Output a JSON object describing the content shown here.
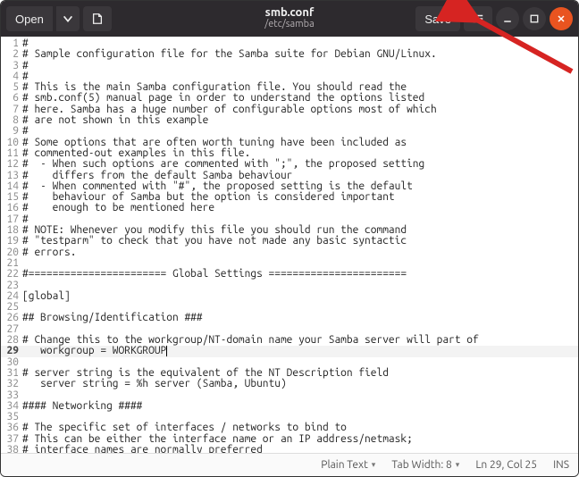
{
  "header": {
    "open_label": "Open",
    "title": "smb.conf",
    "subtitle": "/etc/samba",
    "save_label": "Save"
  },
  "editor": {
    "cursor_line": 29,
    "cursor_col": 25,
    "lines": [
      {
        "n": 1,
        "t": "#"
      },
      {
        "n": 2,
        "t": "# Sample configuration file for the Samba suite for Debian GNU/Linux."
      },
      {
        "n": 3,
        "t": "#"
      },
      {
        "n": 4,
        "t": "#"
      },
      {
        "n": 5,
        "t": "# This is the main Samba configuration file. You should read the"
      },
      {
        "n": 6,
        "t": "# smb.conf(5) manual page in order to understand the options listed"
      },
      {
        "n": 7,
        "t": "# here. Samba has a huge number of configurable options most of which"
      },
      {
        "n": 8,
        "t": "# are not shown in this example"
      },
      {
        "n": 9,
        "t": "#"
      },
      {
        "n": 10,
        "t": "# Some options that are often worth tuning have been included as"
      },
      {
        "n": 11,
        "t": "# commented-out examples in this file."
      },
      {
        "n": 12,
        "t": "#  - When such options are commented with \";\", the proposed setting"
      },
      {
        "n": 13,
        "t": "#    differs from the default Samba behaviour"
      },
      {
        "n": 14,
        "t": "#  - When commented with \"#\", the proposed setting is the default"
      },
      {
        "n": 15,
        "t": "#    behaviour of Samba but the option is considered important"
      },
      {
        "n": 16,
        "t": "#    enough to be mentioned here"
      },
      {
        "n": 17,
        "t": "#"
      },
      {
        "n": 18,
        "t": "# NOTE: Whenever you modify this file you should run the command"
      },
      {
        "n": 19,
        "t": "# \"testparm\" to check that you have not made any basic syntactic"
      },
      {
        "n": 20,
        "t": "# errors."
      },
      {
        "n": 21,
        "t": ""
      },
      {
        "n": 22,
        "t": "#======================= Global Settings ======================="
      },
      {
        "n": 23,
        "t": ""
      },
      {
        "n": 24,
        "t": "[global]"
      },
      {
        "n": 25,
        "t": ""
      },
      {
        "n": 26,
        "t": "## Browsing/Identification ###"
      },
      {
        "n": 27,
        "t": ""
      },
      {
        "n": 28,
        "t": "# Change this to the workgroup/NT-domain name your Samba server will part of"
      },
      {
        "n": 29,
        "t": "   workgroup = WORKGROUP"
      },
      {
        "n": 30,
        "t": ""
      },
      {
        "n": 31,
        "t": "# server string is the equivalent of the NT Description field"
      },
      {
        "n": 32,
        "t": "   server string = %h server (Samba, Ubuntu)"
      },
      {
        "n": 33,
        "t": ""
      },
      {
        "n": 34,
        "t": "#### Networking ####"
      },
      {
        "n": 35,
        "t": ""
      },
      {
        "n": 36,
        "t": "# The specific set of interfaces / networks to bind to"
      },
      {
        "n": 37,
        "t": "# This can be either the interface name or an IP address/netmask;"
      },
      {
        "n": 38,
        "t": "# interface names are normally preferred"
      }
    ]
  },
  "status": {
    "syntax": "Plain Text",
    "tabwidth": "Tab Width: 8",
    "position": "Ln 29, Col 25",
    "overwrite": "INS"
  },
  "annotation": {
    "arrow_color": "#d62422"
  }
}
